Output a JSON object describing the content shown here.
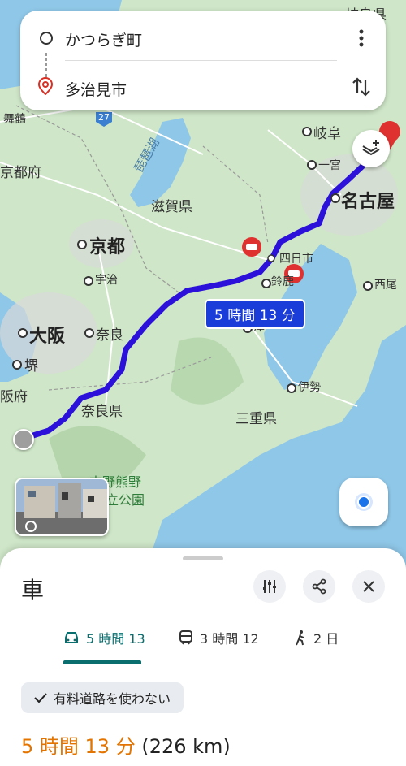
{
  "search": {
    "origin": "かつらぎ町",
    "destination": "多治見市"
  },
  "map": {
    "route_duration_badge": "5 時間 13 分",
    "route_color": "#2b11d9",
    "labels": {
      "gifu_ken": "岐阜県",
      "maizuru": "舞鶴",
      "route27": "27",
      "kyotofu": "京都府",
      "biwako": "琵琶湖",
      "shiga": "滋賀県",
      "gifu": "岐阜",
      "ichinomiya": "一宮",
      "nagoya": "名古屋",
      "kyoto": "京都",
      "uji": "宇治",
      "yokkaichi": "四日市",
      "suzuka": "鈴鹿",
      "nishio": "西尾",
      "osaka": "大阪",
      "nara": "奈良",
      "tsu": "津",
      "sakai": "堺",
      "ise": "伊勢",
      "osakafu": "阪府",
      "naraken": "奈良県",
      "mie": "三重県",
      "yoshino1": "吉野熊野",
      "yoshino2": "立公園"
    }
  },
  "sheet": {
    "title": "車",
    "tabs": [
      {
        "label": "5 時間 13",
        "icon": "car-icon"
      },
      {
        "label": "3 時間 12",
        "icon": "train-icon"
      },
      {
        "label": "2 日",
        "icon": "walk-icon"
      }
    ],
    "filter_chip": "有料道路を使わない",
    "result_time": "5 時間 13 分",
    "result_distance": "(226 km)",
    "accent_color": "#0b6e6e"
  }
}
